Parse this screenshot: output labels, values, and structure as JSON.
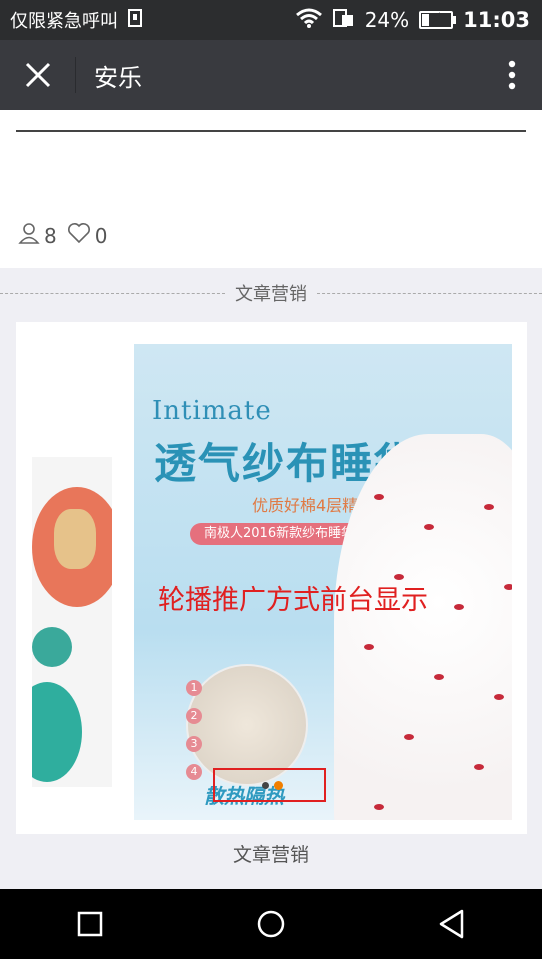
{
  "status_bar": {
    "carrier": "仅限紧急呼叫",
    "battery_percent": "24%",
    "battery_level": 0.24,
    "time": "11:03"
  },
  "title_bar": {
    "title": "安乐"
  },
  "stats": {
    "views": "8",
    "likes": "0"
  },
  "separator": {
    "label": "文章营销"
  },
  "banner": {
    "brand_en": "Intimate",
    "brand_cn": "透气纱布睡袋!",
    "brand_sub": "优质好棉4层精纺",
    "pill": "南极人2016新款纱布睡袋",
    "bottom_tag": "散热隔热",
    "badges": [
      "1",
      "2",
      "3",
      "4"
    ]
  },
  "annotation": "轮播推广方式前台显示",
  "caption": "文章营销",
  "colors": {
    "status_bar_bg": "#2c2d2f",
    "title_bar_bg": "#393a3f",
    "annotation_red": "#e02020",
    "indicator_orange": "#f07f00"
  },
  "icons": [
    "wifi-icon",
    "sim-icon",
    "battery-icon",
    "close-icon",
    "more-vert-icon",
    "user-icon",
    "heart-icon",
    "recent-apps-icon",
    "home-icon",
    "back-icon"
  ]
}
